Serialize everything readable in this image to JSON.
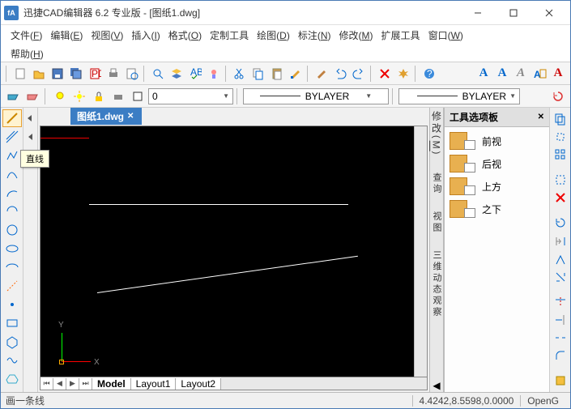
{
  "window": {
    "title": "迅捷CAD编辑器 6.2 专业版  -  [图纸1.dwg]",
    "app_icon": "fA"
  },
  "menu": {
    "file": "文件",
    "edit": "编辑",
    "view": "视图",
    "insert": "插入",
    "format": "格式",
    "custom": "定制工具",
    "draw": "绘图",
    "annotate": "标注",
    "modify": "修改",
    "ext": "扩展工具",
    "window": "窗口",
    "help": "帮助",
    "file_k": "F",
    "edit_k": "E",
    "view_k": "V",
    "insert_k": "I",
    "format_k": "O",
    "draw_k": "D",
    "annotate_k": "N",
    "modify_k": "M",
    "window_k": "W",
    "help_k": "H"
  },
  "toolbar2": {
    "layer_combo": "0",
    "linetype": "BYLAYER",
    "lineweight": "BYLAYER"
  },
  "doc": {
    "tab": "图纸1.dwg"
  },
  "tooltip": {
    "line": "直线"
  },
  "axis": {
    "x": "X",
    "y": "Y"
  },
  "layouts": {
    "model": "Model",
    "l1": "Layout1",
    "l2": "Layout2"
  },
  "sidetabs": {
    "modify": "修改",
    "query": "查询",
    "view": "视图",
    "dyn": "三维动态观察"
  },
  "palette": {
    "title": "工具选项板",
    "items": [
      "前视",
      "后视",
      "上方",
      "之下"
    ]
  },
  "status": {
    "left": "画一条线",
    "coords": "4.4242,8.5598,0.0000",
    "right": "OpenG"
  },
  "textA": {
    "a": "A"
  }
}
